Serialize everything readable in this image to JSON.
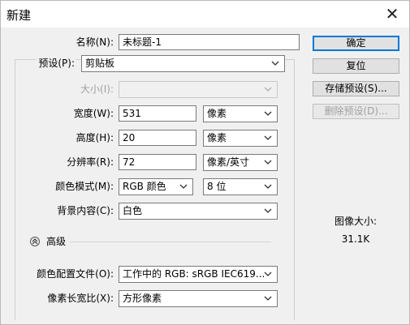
{
  "window": {
    "title": "新建"
  },
  "form": {
    "name_label": "名称(N):",
    "name_value": "未标题-1",
    "preset_label": "预设(P):",
    "preset_value": "剪贴板",
    "size_label": "大小(I):",
    "width_label": "宽度(W):",
    "width_value": "531",
    "width_unit": "像素",
    "height_label": "高度(H):",
    "height_value": "20",
    "height_unit": "像素",
    "resolution_label": "分辨率(R):",
    "resolution_value": "72",
    "resolution_unit": "像素/英寸",
    "color_mode_label": "颜色模式(M):",
    "color_mode_value": "RGB 颜色",
    "bit_depth_value": "8 位",
    "background_label": "背景内容(C):",
    "background_value": "白色",
    "advanced_label": "高级",
    "color_profile_label": "颜色配置文件(O):",
    "color_profile_value": "工作中的 RGB: sRGB IEC619...",
    "pixel_aspect_label": "像素长宽比(X):",
    "pixel_aspect_value": "方形像素"
  },
  "buttons": {
    "ok": "确定",
    "reset": "复位",
    "save_preset": "存储预设(S)...",
    "delete_preset": "删除预设(D)..."
  },
  "info": {
    "image_size_label": "图像大小:",
    "image_size_value": "31.1K"
  },
  "colors": {
    "accent": "#0078d7",
    "background": "#f0f0f0"
  },
  "icons": {
    "close": "close-icon",
    "dropdown": "chevron-down-icon",
    "advanced": "chevron-up-circle-icon"
  }
}
